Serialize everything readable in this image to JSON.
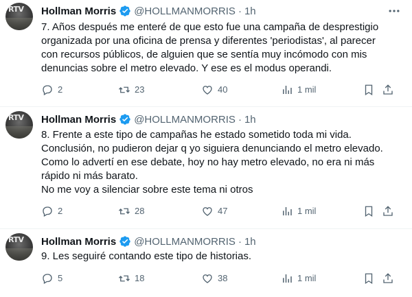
{
  "tweets": [
    {
      "name": "Hollman Morris",
      "handle": "@HOLLMANMORRIS",
      "separator": "·",
      "time": "1h",
      "avatar_text": "RTV",
      "text": "7. Años después me enteré de que esto fue una campaña de desprestigio\norganizada por una oficina de prensa y diferentes 'periodistas', al parecer\ncon recursos públicos, de alguien que se sentía muy incómodo con mis\ndenuncias sobre el metro elevado. Y ese es el modus operandi.",
      "replies": "2",
      "retweets": "23",
      "likes": "40",
      "views": "1 mil"
    },
    {
      "name": "Hollman Morris",
      "handle": "@HOLLMANMORRIS",
      "separator": "·",
      "time": "1h",
      "avatar_text": "RTV",
      "text": "8. Frente a este tipo de campañas he estado sometido toda mi vida.\nConclusión, no pudieron dejar q yo siguiera denunciando el metro elevado.\nComo lo advertí en ese debate, hoy no hay metro elevado, no era ni más\nrápido ni más barato.\nNo me voy a silenciar sobre este tema ni otros",
      "replies": "2",
      "retweets": "28",
      "likes": "47",
      "views": "1 mil"
    },
    {
      "name": "Hollman Morris",
      "handle": "@HOLLMANMORRIS",
      "separator": "·",
      "time": "1h",
      "avatar_text": "RTV",
      "text": "9. Les seguiré contando este tipo de historias.",
      "replies": "5",
      "retweets": "18",
      "likes": "38",
      "views": "1 mil"
    }
  ],
  "icons": {
    "verified": "verified-badge-icon",
    "more": "more-options-icon",
    "reply": "reply-icon",
    "retweet": "retweet-icon",
    "like": "heart-icon",
    "views": "views-chart-icon",
    "bookmark": "bookmark-icon",
    "share": "share-icon"
  },
  "colors": {
    "verified": "#1d9bf0",
    "text": "#0f1419",
    "muted": "#536471",
    "divider": "#eff3f4"
  }
}
